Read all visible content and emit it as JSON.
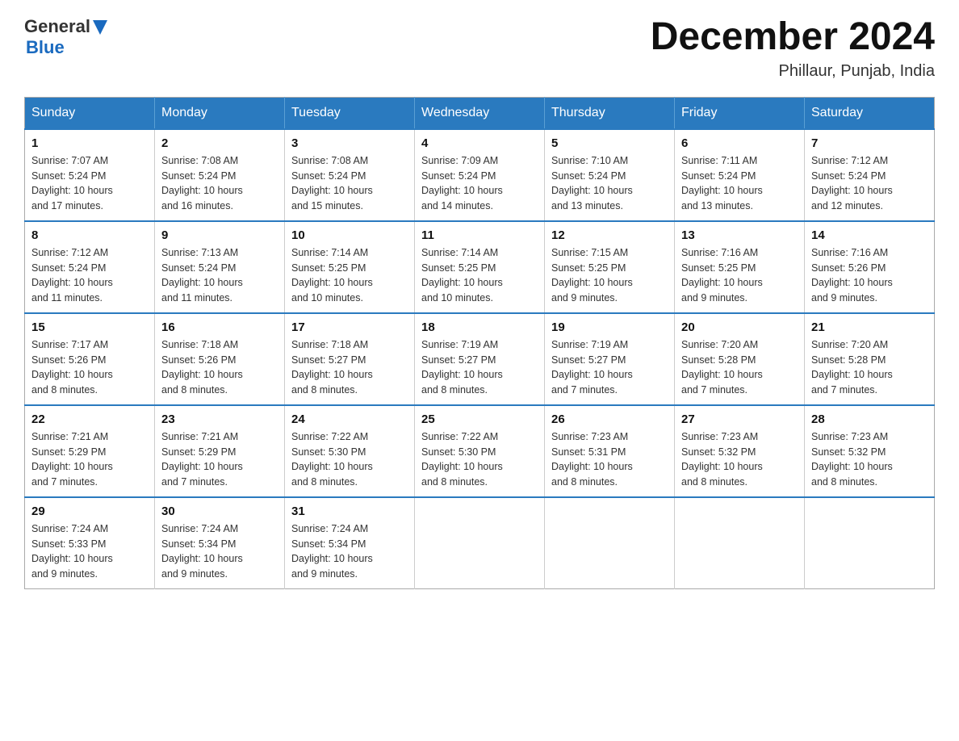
{
  "logo": {
    "general": "General",
    "blue": "Blue"
  },
  "title": "December 2024",
  "subtitle": "Phillaur, Punjab, India",
  "days_header": [
    "Sunday",
    "Monday",
    "Tuesday",
    "Wednesday",
    "Thursday",
    "Friday",
    "Saturday"
  ],
  "weeks": [
    [
      {
        "day": "1",
        "info": "Sunrise: 7:07 AM\nSunset: 5:24 PM\nDaylight: 10 hours\nand 17 minutes."
      },
      {
        "day": "2",
        "info": "Sunrise: 7:08 AM\nSunset: 5:24 PM\nDaylight: 10 hours\nand 16 minutes."
      },
      {
        "day": "3",
        "info": "Sunrise: 7:08 AM\nSunset: 5:24 PM\nDaylight: 10 hours\nand 15 minutes."
      },
      {
        "day": "4",
        "info": "Sunrise: 7:09 AM\nSunset: 5:24 PM\nDaylight: 10 hours\nand 14 minutes."
      },
      {
        "day": "5",
        "info": "Sunrise: 7:10 AM\nSunset: 5:24 PM\nDaylight: 10 hours\nand 13 minutes."
      },
      {
        "day": "6",
        "info": "Sunrise: 7:11 AM\nSunset: 5:24 PM\nDaylight: 10 hours\nand 13 minutes."
      },
      {
        "day": "7",
        "info": "Sunrise: 7:12 AM\nSunset: 5:24 PM\nDaylight: 10 hours\nand 12 minutes."
      }
    ],
    [
      {
        "day": "8",
        "info": "Sunrise: 7:12 AM\nSunset: 5:24 PM\nDaylight: 10 hours\nand 11 minutes."
      },
      {
        "day": "9",
        "info": "Sunrise: 7:13 AM\nSunset: 5:24 PM\nDaylight: 10 hours\nand 11 minutes."
      },
      {
        "day": "10",
        "info": "Sunrise: 7:14 AM\nSunset: 5:25 PM\nDaylight: 10 hours\nand 10 minutes."
      },
      {
        "day": "11",
        "info": "Sunrise: 7:14 AM\nSunset: 5:25 PM\nDaylight: 10 hours\nand 10 minutes."
      },
      {
        "day": "12",
        "info": "Sunrise: 7:15 AM\nSunset: 5:25 PM\nDaylight: 10 hours\nand 9 minutes."
      },
      {
        "day": "13",
        "info": "Sunrise: 7:16 AM\nSunset: 5:25 PM\nDaylight: 10 hours\nand 9 minutes."
      },
      {
        "day": "14",
        "info": "Sunrise: 7:16 AM\nSunset: 5:26 PM\nDaylight: 10 hours\nand 9 minutes."
      }
    ],
    [
      {
        "day": "15",
        "info": "Sunrise: 7:17 AM\nSunset: 5:26 PM\nDaylight: 10 hours\nand 8 minutes."
      },
      {
        "day": "16",
        "info": "Sunrise: 7:18 AM\nSunset: 5:26 PM\nDaylight: 10 hours\nand 8 minutes."
      },
      {
        "day": "17",
        "info": "Sunrise: 7:18 AM\nSunset: 5:27 PM\nDaylight: 10 hours\nand 8 minutes."
      },
      {
        "day": "18",
        "info": "Sunrise: 7:19 AM\nSunset: 5:27 PM\nDaylight: 10 hours\nand 8 minutes."
      },
      {
        "day": "19",
        "info": "Sunrise: 7:19 AM\nSunset: 5:27 PM\nDaylight: 10 hours\nand 7 minutes."
      },
      {
        "day": "20",
        "info": "Sunrise: 7:20 AM\nSunset: 5:28 PM\nDaylight: 10 hours\nand 7 minutes."
      },
      {
        "day": "21",
        "info": "Sunrise: 7:20 AM\nSunset: 5:28 PM\nDaylight: 10 hours\nand 7 minutes."
      }
    ],
    [
      {
        "day": "22",
        "info": "Sunrise: 7:21 AM\nSunset: 5:29 PM\nDaylight: 10 hours\nand 7 minutes."
      },
      {
        "day": "23",
        "info": "Sunrise: 7:21 AM\nSunset: 5:29 PM\nDaylight: 10 hours\nand 7 minutes."
      },
      {
        "day": "24",
        "info": "Sunrise: 7:22 AM\nSunset: 5:30 PM\nDaylight: 10 hours\nand 8 minutes."
      },
      {
        "day": "25",
        "info": "Sunrise: 7:22 AM\nSunset: 5:30 PM\nDaylight: 10 hours\nand 8 minutes."
      },
      {
        "day": "26",
        "info": "Sunrise: 7:23 AM\nSunset: 5:31 PM\nDaylight: 10 hours\nand 8 minutes."
      },
      {
        "day": "27",
        "info": "Sunrise: 7:23 AM\nSunset: 5:32 PM\nDaylight: 10 hours\nand 8 minutes."
      },
      {
        "day": "28",
        "info": "Sunrise: 7:23 AM\nSunset: 5:32 PM\nDaylight: 10 hours\nand 8 minutes."
      }
    ],
    [
      {
        "day": "29",
        "info": "Sunrise: 7:24 AM\nSunset: 5:33 PM\nDaylight: 10 hours\nand 9 minutes."
      },
      {
        "day": "30",
        "info": "Sunrise: 7:24 AM\nSunset: 5:34 PM\nDaylight: 10 hours\nand 9 minutes."
      },
      {
        "day": "31",
        "info": "Sunrise: 7:24 AM\nSunset: 5:34 PM\nDaylight: 10 hours\nand 9 minutes."
      },
      null,
      null,
      null,
      null
    ]
  ]
}
